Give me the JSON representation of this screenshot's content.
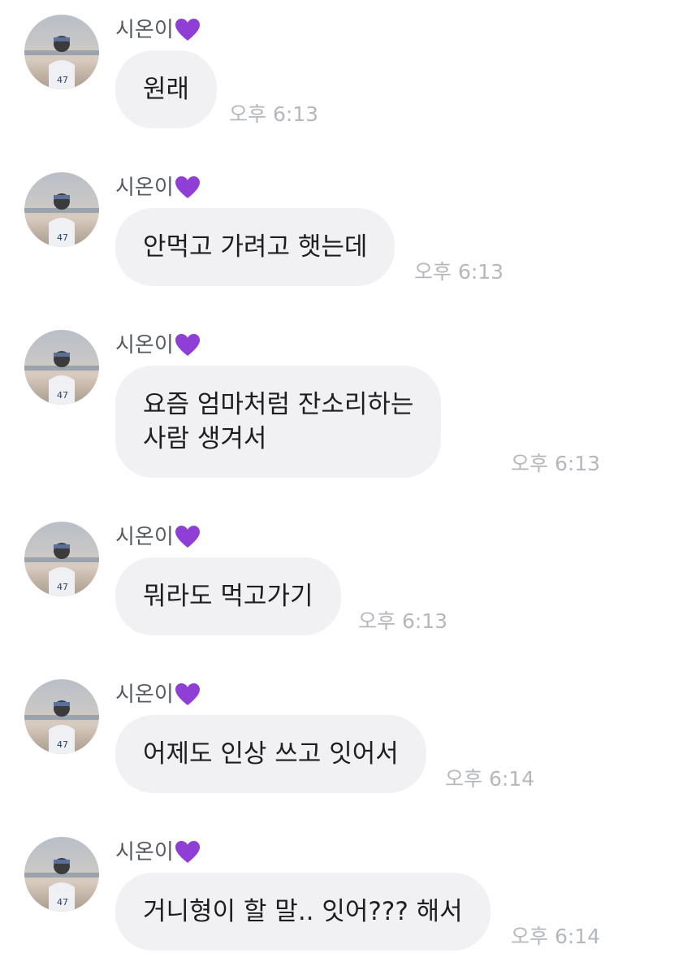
{
  "colors": {
    "bubble": "#f1f1f4",
    "time": "#b4b7bc",
    "sender": "#555a60",
    "heart": "#8f3fd6"
  },
  "messages": [
    {
      "sender": "시온이",
      "sender_icon": "purple-heart-icon",
      "lines": [
        "원래"
      ],
      "time": "오후 6:13"
    },
    {
      "sender": "시온이",
      "sender_icon": "purple-heart-icon",
      "lines": [
        "안먹고 가려고 햇는데"
      ],
      "time": "오후 6:13"
    },
    {
      "sender": "시온이",
      "sender_icon": "purple-heart-icon",
      "lines": [
        "요즘 엄마처럼 잔소리하는",
        "사람 생겨서"
      ],
      "time": "오후 6:13"
    },
    {
      "sender": "시온이",
      "sender_icon": "purple-heart-icon",
      "lines": [
        "뭐라도 먹고가기"
      ],
      "time": "오후 6:13"
    },
    {
      "sender": "시온이",
      "sender_icon": "purple-heart-icon",
      "lines": [
        "어제도 인상 쓰고 잇어서"
      ],
      "time": "오후 6:14"
    },
    {
      "sender": "시온이",
      "sender_icon": "purple-heart-icon",
      "lines": [
        "거니형이 할 말.. 잇어??? 해서"
      ],
      "time": "오후 6:14"
    }
  ]
}
